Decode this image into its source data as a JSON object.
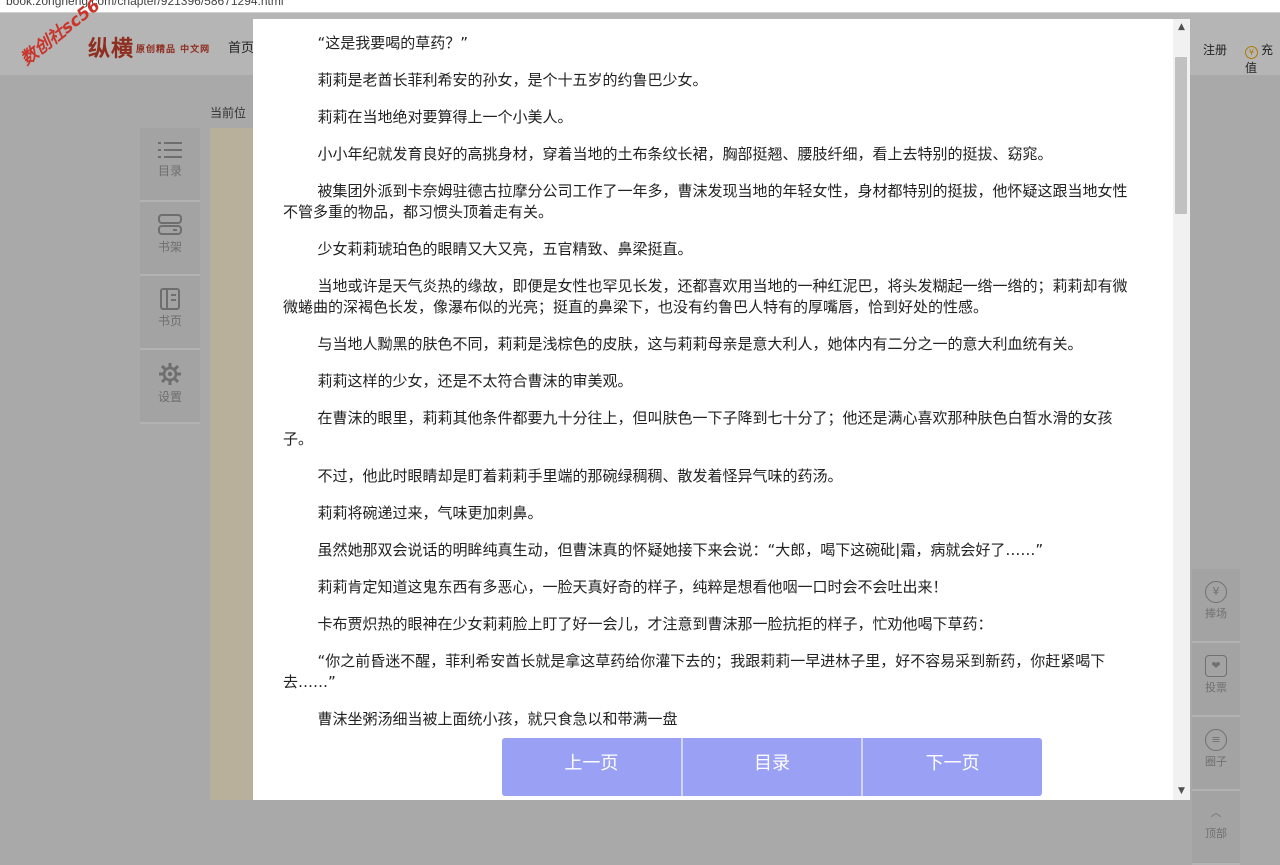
{
  "browser": {
    "url": "book.zongheng.com/chapter/921396/58671294.html"
  },
  "header": {
    "logo_text": "纵横",
    "logo_sub": "原创精品 中文网",
    "nav_home": "首页",
    "register": "注册",
    "charge": "充值",
    "charge_icon": "yen-coin-icon"
  },
  "watermark": "数创社sc56",
  "breadcrumb": "当前位",
  "left_tools": [
    {
      "label": "目录",
      "icon": "list-icon"
    },
    {
      "label": "书架",
      "icon": "bookshelf-icon"
    },
    {
      "label": "书页",
      "icon": "book-icon"
    },
    {
      "label": "设置",
      "icon": "gear-icon"
    }
  ],
  "right_tools": [
    {
      "label": "捧场",
      "icon": "yen-icon",
      "glyph": "¥"
    },
    {
      "label": "投票",
      "icon": "ticket-icon",
      "glyph": "❤"
    },
    {
      "label": "圈子",
      "icon": "chat-icon",
      "glyph": "≡"
    },
    {
      "label": "顶部",
      "icon": "chevron-up-icon",
      "glyph": "︿"
    }
  ],
  "chapter": {
    "paragraphs": [
      "“这是我要喝的草药？”",
      "莉莉是老酋长菲利希安的孙女，是个十五岁的约鲁巴少女。",
      "莉莉在当地绝对要算得上一个小美人。",
      "小小年纪就发育良好的高挑身材，穿着当地的土布条纹长裙，胸部挺翘、腰肢纤细，看上去特别的挺拔、窈窕。",
      "被集团外派到卡奈姆驻德古拉摩分公司工作了一年多，曹沫发现当地的年轻女性，身材都特别的挺拔，他怀疑这跟当地女性不管多重的物品，都习惯头顶着走有关。",
      "少女莉莉琥珀色的眼睛又大又亮，五官精致、鼻梁挺直。",
      "当地或许是天气炎热的缘故，即便是女性也罕见长发，还都喜欢用当地的一种红泥巴，将头发糊起一绺一绺的；莉莉却有微微蜷曲的深褐色长发，像瀑布似的光亮；挺直的鼻梁下，也没有约鲁巴人特有的厚嘴唇，恰到好处的性感。",
      "与当地人黝黑的肤色不同，莉莉是浅棕色的皮肤，这与莉莉母亲是意大利人，她体内有二分之一的意大利血统有关。",
      "莉莉这样的少女，还是不太符合曹沫的审美观。",
      "在曹沫的眼里，莉莉其他条件都要九十分往上，但叫肤色一下子降到七十分了；他还是满心喜欢那种肤色白皙水滑的女孩子。",
      "不过，他此时眼睛却是盯着莉莉手里端的那碗绿稠稠、散发着怪异气味的药汤。",
      "莉莉将碗递过来，气味更加刺鼻。",
      "虽然她那双会说话的明眸纯真生动，但曹沫真的怀疑她接下来会说：“大郎，喝下这碗砒|霜，病就会好了……”",
      "莉莉肯定知道这鬼东西有多恶心，一脸天真好奇的样子，纯粹是想看他咽一口时会不会吐出来！",
      "卡布贾炽热的眼神在少女莉莉脸上盯了好一会儿，才注意到曹沫那一脸抗拒的样子，忙劝他喝下草药：",
      "“你之前昏迷不醒，菲利希安酋长就是拿这草药给你灌下去的；我跟莉莉一早进林子里，好不容易采到新药，你赶紧喝下去……”",
      "曹沫坐粥汤细当被上面统小孩，就只食急以和带满一盘"
    ]
  },
  "pager": {
    "prev": "上一页",
    "toc": "目录",
    "next": "下一页"
  }
}
